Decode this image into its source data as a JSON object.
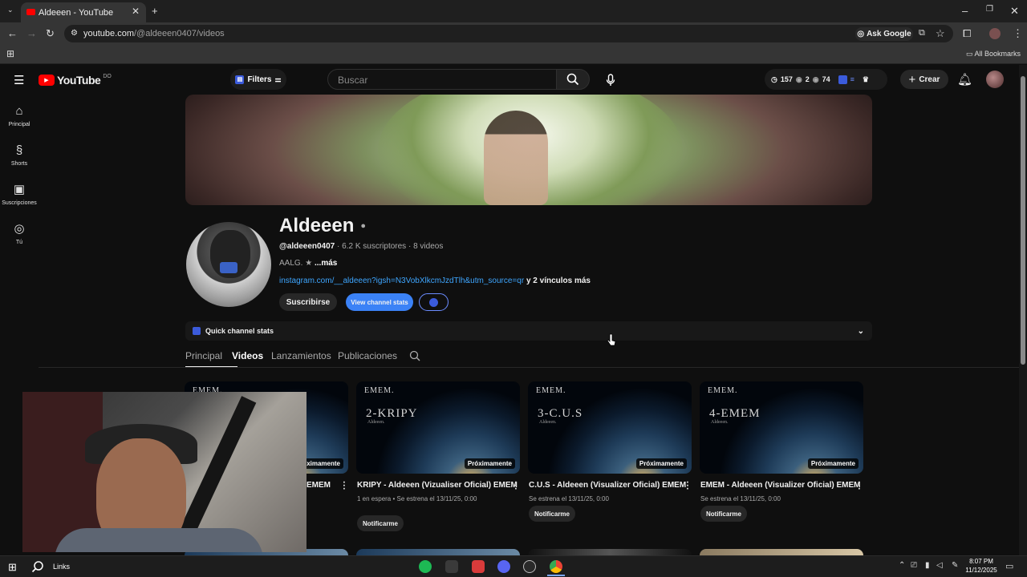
{
  "browser": {
    "tab_title": "Aldeeen - YouTube",
    "url_domain": "youtube.com",
    "url_path": "/@aldeeen0407/videos",
    "ask_google": "Ask Google",
    "all_bookmarks": "All Bookmarks"
  },
  "header": {
    "logo_text": "YouTube",
    "logo_country": "DO",
    "filters_label": "Filters",
    "search_placeholder": "Buscar",
    "stats": {
      "clock": "157",
      "eye1": "2",
      "eye2": "74"
    },
    "create_label": "Crear"
  },
  "sidebar": {
    "items": [
      {
        "label": "Principal",
        "icon": "home-icon"
      },
      {
        "label": "Shorts",
        "icon": "shorts-icon"
      },
      {
        "label": "Suscripciones",
        "icon": "subscriptions-icon"
      },
      {
        "label": "Tú",
        "icon": "you-icon"
      }
    ]
  },
  "channel": {
    "name": "Aldeeen",
    "handle": "@aldeeen0407",
    "subscribers": "6.2 K suscriptores",
    "videos_count": "8 videos",
    "description": "AALG. ★",
    "more": "...más",
    "link": "instagram.com/__aldeeen?igsh=N3VobXlkcmJzdTlh&utm_source=qr",
    "more_links": "y 2 vínculos más",
    "subscribe_label": "Suscribirse",
    "stats_button": "View channel stats",
    "quick_stats_label": "Quick channel stats"
  },
  "tabs": [
    "Principal",
    "Videos",
    "Lanzamientos",
    "Publicaciones"
  ],
  "videos": [
    {
      "thumb_top": "EMEM.",
      "thumb_big": "",
      "thumb_small": "",
      "badge": "Próximamente",
      "title": "EMEM",
      "meta": "",
      "button": ""
    },
    {
      "thumb_top": "EMEM.",
      "thumb_big": "2-KRIPY",
      "thumb_small": "Aldeeen.",
      "badge": "Próximamente",
      "title": "KRIPY - Aldeeen (Vizualiser Oficial) EMEM",
      "meta": "1 en espera • Se estrena el 13/11/25, 0:00",
      "button": "Notificarme"
    },
    {
      "thumb_top": "EMEM.",
      "thumb_big": "3-C.U.S",
      "thumb_small": "Aldeeen.",
      "badge": "Próximamente",
      "title": "C.U.S - Aldeeen (Visualizer Oficial) EMEM",
      "meta": "Se estrena el 13/11/25, 0:00",
      "button": "Notificarme"
    },
    {
      "thumb_top": "EMEM.",
      "thumb_big": "4-EMEM",
      "thumb_small": "Aldeeen.",
      "badge": "Próximamente",
      "title": "EMEM - Aldeeen (Visualizer Oficial) EMEM",
      "meta": "Se estrena el 13/11/25, 0:00",
      "button": "Notificarme"
    }
  ],
  "taskbar": {
    "links_label": "Links",
    "time": "8:07 PM",
    "date": "11/12/2025"
  },
  "colors": {
    "accent_blue": "#3ea6ff",
    "youtube_red": "#ff0000",
    "stats_button": "#3b82f6"
  }
}
